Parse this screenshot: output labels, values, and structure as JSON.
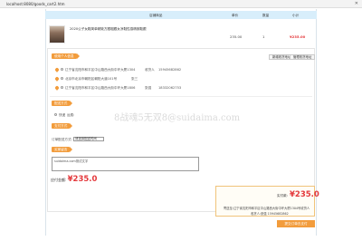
{
  "browser": {
    "url": "localhost:8080/goods_cart2.htm",
    "close_glyph": "✕"
  },
  "table": {
    "headers": [
      "店铺商品",
      "单价",
      "数量",
      "小计"
    ],
    "row": {
      "name": "2020公子女鞋简单精致方跟粗跟女凉鞋性感精致鞋跟",
      "price": "235.00",
      "quantity": "1",
      "subtotal": "¥235.00"
    }
  },
  "address": {
    "tag": "使用个人信息",
    "buttons": [
      "新增收货地址",
      "管理收货地址"
    ],
    "items": [
      {
        "text": "辽宁省沈阳市和平区中山路西大街中环大厦1304",
        "name_label": "收货人",
        "phone": "15945682862"
      },
      {
        "text": "北京市北京市朝阳区朝阳大道101号",
        "name_label": "张三",
        "phone": ""
      },
      {
        "text": "辽宁省沈阳市和平区中山路西大街中环大厦1806",
        "name_label": "张强",
        "phone": "18332062753"
      }
    ]
  },
  "shipping": {
    "tag": "配送方式",
    "option_label": "快递",
    "option_prefix": "运费:"
  },
  "payment": {
    "tag": "支付方式",
    "select_label": "订单配送方式:",
    "select_value": "请选择配送时间"
  },
  "remark": {
    "tag": "买家留言",
    "value": "suidaima.com测试文字"
  },
  "total_left": {
    "label": "应付金额:",
    "amount": "¥235.0"
  },
  "summary": {
    "label": "实付款:",
    "amount": "¥235.0",
    "address_line": "寄送至:辽宁省沈阳市和平区中山路西大街中环大厦1304号收货人",
    "receiver_line": "收货人:张强 15945682862"
  },
  "submit_label": "提交订单去支付",
  "watermark": "8战魂5无双8@suidaima.com"
}
